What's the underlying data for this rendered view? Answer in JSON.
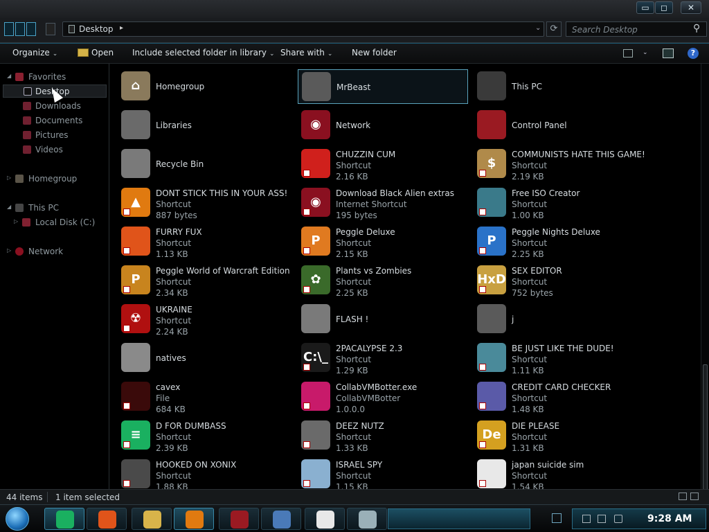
{
  "window": {
    "min_label": "▭",
    "max_label": "◻",
    "close_label": "✕"
  },
  "address": {
    "location": "Desktop",
    "arrow": "▸",
    "dropdown": "⌄",
    "refresh": "⟳",
    "search_placeholder": "Search Desktop",
    "search_icon": "⚲"
  },
  "toolbar": {
    "organize": "Organize",
    "open": "Open",
    "include": "Include selected folder in library",
    "share": "Share with",
    "new_folder": "New folder",
    "caret": "⌄",
    "help": "?"
  },
  "nav": {
    "favorites": "Favorites",
    "desktop": "Desktop",
    "downloads": "Downloads",
    "documents": "Documents",
    "pictures": "Pictures",
    "videos": "Videos",
    "homegroup": "Homegroup",
    "this_pc": "This PC",
    "local_disk": "Local Disk (C:)",
    "network": "Network",
    "expanded_tri": "◢",
    "collapsed_tri": "▷"
  },
  "items": [
    {
      "name": "Homegroup",
      "line2": "",
      "line3": "",
      "icon": "house-icon",
      "color": "#8a7a5c",
      "glyph": "⌂"
    },
    {
      "name": "MrBeast",
      "line2": "",
      "line3": "",
      "icon": "folder-icon",
      "color": "#5a5a5a",
      "glyph": ""
    },
    {
      "name": "This PC",
      "line2": "",
      "line3": "",
      "icon": "computer-icon",
      "color": "#3a3a3a",
      "glyph": ""
    },
    {
      "name": "Libraries",
      "line2": "",
      "line3": "",
      "icon": "library-icon",
      "color": "#6a6a6a",
      "glyph": ""
    },
    {
      "name": "Network",
      "line2": "",
      "line3": "",
      "icon": "network-icon",
      "color": "#8a1020",
      "glyph": "◉"
    },
    {
      "name": "Control Panel",
      "line2": "",
      "line3": "",
      "icon": "control-panel-icon",
      "color": "#9a1a22",
      "glyph": ""
    },
    {
      "name": "Recycle Bin",
      "line2": "",
      "line3": "",
      "icon": "recycle-bin-icon",
      "color": "#7a7a7a",
      "glyph": ""
    },
    {
      "name": "CHUZZIN CUM",
      "line2": "Shortcut",
      "line3": "2.16 KB",
      "icon": "chuzzle-icon",
      "color": "#d0201c",
      "glyph": ""
    },
    {
      "name": "COMMUNISTS HATE THIS GAME!",
      "line2": "Shortcut",
      "line3": "2.19 KB",
      "icon": "money-bag-icon",
      "color": "#b08a4a",
      "glyph": "$"
    },
    {
      "name": "DONT STICK THIS IN YOUR ASS!",
      "line2": "Shortcut",
      "line3": "887 bytes",
      "icon": "vlc-icon",
      "color": "#e07a10",
      "glyph": "▲"
    },
    {
      "name": "Download Black Alien extras",
      "line2": "Internet Shortcut",
      "line3": "195 bytes",
      "icon": "internet-shortcut-icon",
      "color": "#8a1020",
      "glyph": "◉"
    },
    {
      "name": "Free ISO Creator",
      "line2": "Shortcut",
      "line3": "1.00 KB",
      "icon": "iso-creator-icon",
      "color": "#3a7a8a",
      "glyph": ""
    },
    {
      "name": "FURRY FUX",
      "line2": "Shortcut",
      "line3": "1.13 KB",
      "icon": "firefox-icon",
      "color": "#e0541a",
      "glyph": ""
    },
    {
      "name": "Peggle Deluxe",
      "line2": "Shortcut",
      "line3": "2.15 KB",
      "icon": "peggle-icon",
      "color": "#e07a20",
      "glyph": "P"
    },
    {
      "name": "Peggle Nights Deluxe",
      "line2": "Shortcut",
      "line3": "2.25 KB",
      "icon": "peggle-nights-icon",
      "color": "#2a72c8",
      "glyph": "P"
    },
    {
      "name": "Peggle World of Warcraft Edition",
      "line2": "Shortcut",
      "line3": "2.34 KB",
      "icon": "peggle-wow-icon",
      "color": "#c8841e",
      "glyph": "P"
    },
    {
      "name": "Plants vs Zombies",
      "line2": "Shortcut",
      "line3": "2.25 KB",
      "icon": "plants-vs-zombies-icon",
      "color": "#3a6a2a",
      "glyph": "✿"
    },
    {
      "name": "SEX EDITOR",
      "line2": "Shortcut",
      "line3": "752 bytes",
      "icon": "hex-editor-icon",
      "color": "#c8a040",
      "glyph": "HxD"
    },
    {
      "name": "UKRAINE",
      "line2": "Shortcut",
      "line3": "2.24 KB",
      "icon": "radiation-icon",
      "color": "#b01010",
      "glyph": "☢"
    },
    {
      "name": "FLASH !",
      "line2": "",
      "line3": "",
      "icon": "flash-folder-icon",
      "color": "#7a7a7a",
      "glyph": ""
    },
    {
      "name": "j",
      "line2": "",
      "line3": "",
      "icon": "folder-icon",
      "color": "#5a5a5a",
      "glyph": ""
    },
    {
      "name": "natives",
      "line2": "",
      "line3": "",
      "icon": "folder-icon",
      "color": "#8a8a8a",
      "glyph": ""
    },
    {
      "name": "2PACALYPSE 2.3",
      "line2": "Shortcut",
      "line3": "1.29 KB",
      "icon": "console-icon",
      "color": "#1a1a1a",
      "glyph": "C:\\_"
    },
    {
      "name": "BE JUST LIKE THE DUDE!",
      "line2": "Shortcut",
      "line3": "1.11 KB",
      "icon": "dude-icon",
      "color": "#4a8a9a",
      "glyph": ""
    },
    {
      "name": "cavex",
      "line2": "File",
      "line3": "684 KB",
      "icon": "file-icon",
      "color": "#3a0a0a",
      "glyph": ""
    },
    {
      "name": "CollabVMBotter.exe",
      "line2": "CollabVMBotter",
      "line3": "1.0.0.0",
      "icon": "application-icon",
      "color": "#c81a6a",
      "glyph": ""
    },
    {
      "name": "CREDIT CARD CHECKER",
      "line2": "Shortcut",
      "line3": "1.48 KB",
      "icon": "credit-card-icon",
      "color": "#5a5aa8",
      "glyph": ""
    },
    {
      "name": "D FOR DUMBASS",
      "line2": "Shortcut",
      "line3": "2.39 KB",
      "icon": "chat-bubble-icon",
      "color": "#1ab060",
      "glyph": "≡"
    },
    {
      "name": "DEEZ NUTZ",
      "line2": "Shortcut",
      "line3": "1.33 KB",
      "icon": "stacked-windows-icon",
      "color": "#6a6a6a",
      "glyph": ""
    },
    {
      "name": "DIE PLEASE",
      "line2": "Shortcut",
      "line3": "1.31 KB",
      "icon": "de-icon",
      "color": "#d4a020",
      "glyph": "De"
    },
    {
      "name": "HOOKED ON XONIX",
      "line2": "Shortcut",
      "line3": "1.88 KB",
      "icon": "xonix-icon",
      "color": "#4a4a4a",
      "glyph": ""
    },
    {
      "name": "ISRAEL SPY",
      "line2": "Shortcut",
      "line3": "1.15 KB",
      "icon": "network-spy-icon",
      "color": "#8ab0d0",
      "glyph": ""
    },
    {
      "name": "japan suicide sim",
      "line2": "Shortcut",
      "line3": "1.54 KB",
      "icon": "japan-sim-icon",
      "color": "#e8e8e8",
      "glyph": ""
    }
  ],
  "status": {
    "count": "44 items",
    "selected": "1 item selected"
  },
  "taskbar": {
    "clock": "9:28 AM",
    "buttons": [
      {
        "icon": "chat-bubble-icon",
        "color": "#1ab060"
      },
      {
        "icon": "firefox-icon",
        "color": "#e0541a"
      },
      {
        "icon": "file-explorer-icon",
        "color": "#d8b44a"
      },
      {
        "icon": "search-magnifier-icon",
        "color": "#e07a10"
      },
      {
        "icon": "control-panel-icon",
        "color": "#9a1a22"
      },
      {
        "icon": "network-computer-icon",
        "color": "#4a7ab8"
      },
      {
        "icon": "7zip-icon",
        "color": "#e8e8e8"
      },
      {
        "icon": "notepad-icon",
        "color": "#9ab0b8"
      }
    ]
  }
}
